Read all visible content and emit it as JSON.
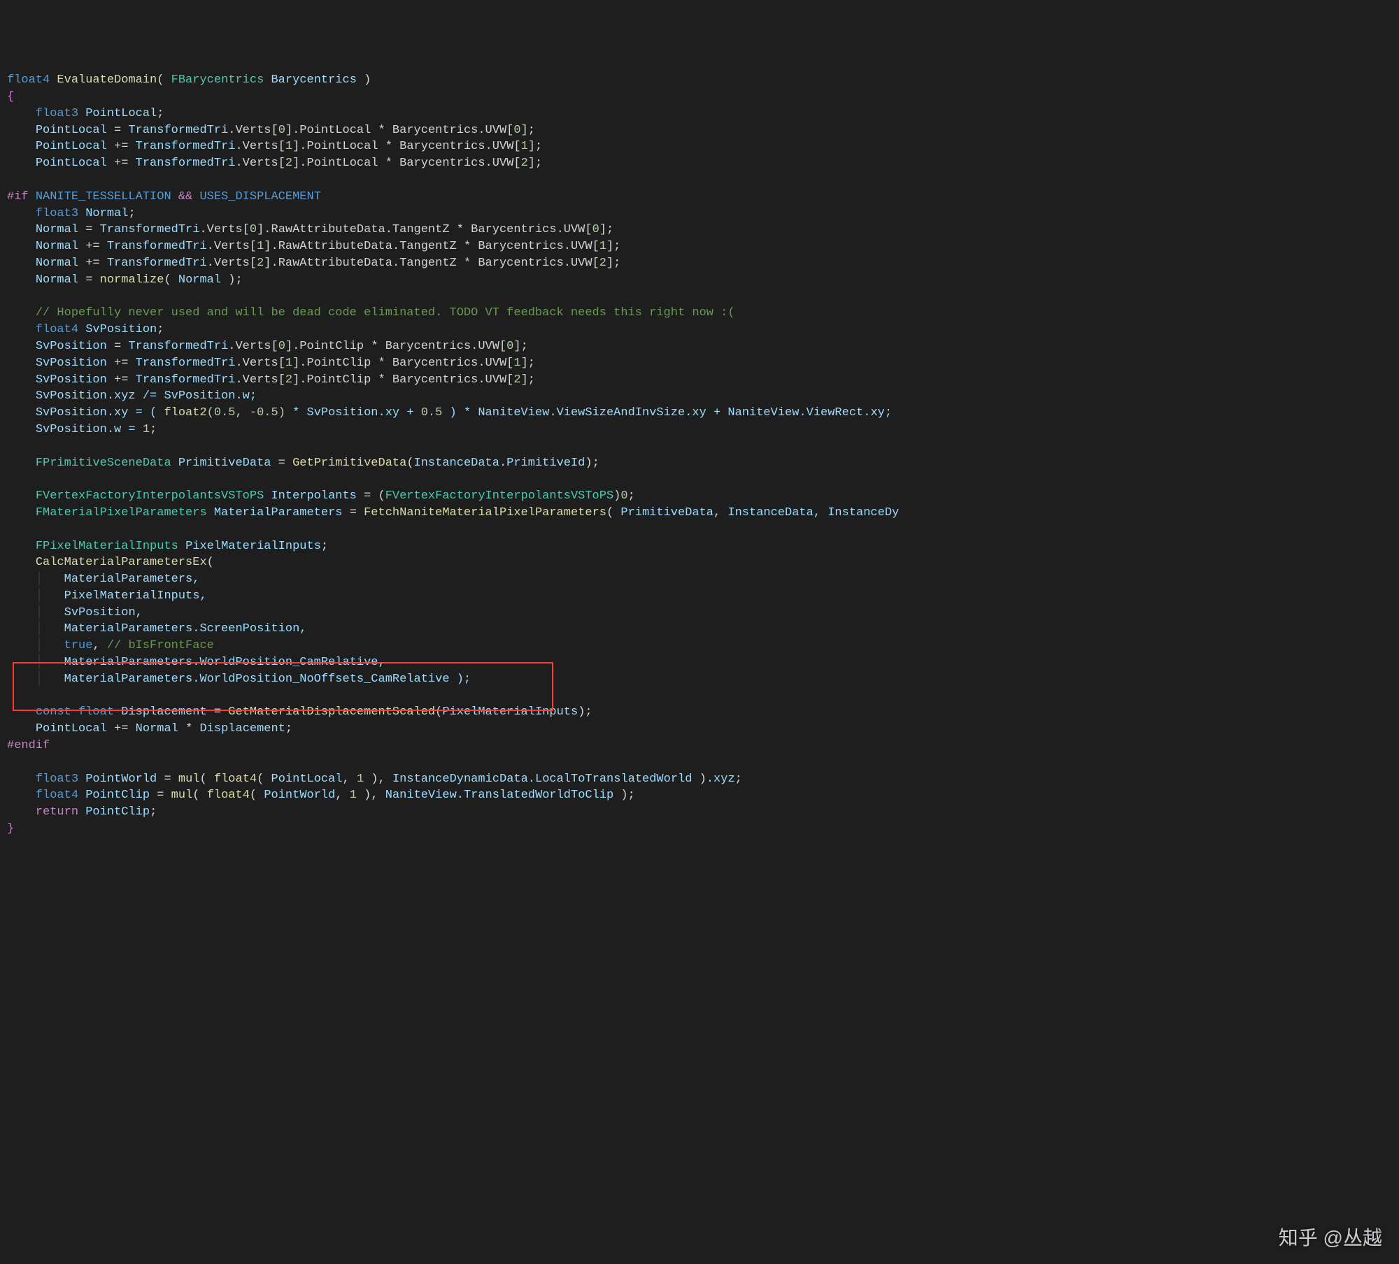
{
  "func_decl": {
    "ret": "float4",
    "name": "EvaluateDomain",
    "ptype": "FBarycentrics",
    "pname": "Barycentrics"
  },
  "l_open": "{",
  "l_close": "}",
  "pl_decl": {
    "t": "float3",
    "n": "PointLocal"
  },
  "pl1": {
    "lhs": "PointLocal",
    "op": " = ",
    "a": "TransformedTri",
    "b": ".Verts[",
    "i": "0",
    "c": "].PointLocal * Barycentrics.UVW[",
    "i2": "0",
    "d": "];"
  },
  "pl2": {
    "lhs": "PointLocal",
    "op": " += ",
    "a": "TransformedTri",
    "b": ".Verts[",
    "i": "1",
    "c": "].PointLocal * Barycentrics.UVW[",
    "i2": "1",
    "d": "];"
  },
  "pl3": {
    "lhs": "PointLocal",
    "op": " += ",
    "a": "TransformedTri",
    "b": ".Verts[",
    "i": "2",
    "c": "].PointLocal * Barycentrics.UVW[",
    "i2": "2",
    "d": "];"
  },
  "pp_if": {
    "d": "#if",
    "c1": "NANITE_TESSELLATION",
    "op": "&&",
    "c2": "USES_DISPLACEMENT"
  },
  "n_decl": {
    "t": "float3",
    "n": "Normal"
  },
  "n1": {
    "lhs": "Normal",
    "op": " = ",
    "a": "TransformedTri",
    "b": ".Verts[",
    "i": "0",
    "c": "].RawAttributeData.TangentZ * Barycentrics.UVW[",
    "i2": "0",
    "d": "];"
  },
  "n2": {
    "lhs": "Normal",
    "op": " += ",
    "a": "TransformedTri",
    "b": ".Verts[",
    "i": "1",
    "c": "].RawAttributeData.TangentZ * Barycentrics.UVW[",
    "i2": "1",
    "d": "];"
  },
  "n3": {
    "lhs": "Normal",
    "op": " += ",
    "a": "TransformedTri",
    "b": ".Verts[",
    "i": "2",
    "c": "].RawAttributeData.TangentZ * Barycentrics.UVW[",
    "i2": "2",
    "d": "];"
  },
  "n_norm": {
    "lhs": "Normal",
    "op": " = ",
    "fn": "normalize",
    "arg": "Normal"
  },
  "comment_dead": "// Hopefully never used and will be dead code eliminated. TODO VT feedback needs this right now :(",
  "sv_decl": {
    "t": "float4",
    "n": "SvPosition"
  },
  "sv1": {
    "lhs": "SvPosition",
    "op": " = ",
    "a": "TransformedTri",
    "b": ".Verts[",
    "i": "0",
    "c": "].PointClip * Barycentrics.UVW[",
    "i2": "0",
    "d": "];"
  },
  "sv2": {
    "lhs": "SvPosition",
    "op": " += ",
    "a": "TransformedTri",
    "b": ".Verts[",
    "i": "1",
    "c": "].PointClip * Barycentrics.UVW[",
    "i2": "1",
    "d": "];"
  },
  "sv3": {
    "lhs": "SvPosition",
    "op": " += ",
    "a": "TransformedTri",
    "b": ".Verts[",
    "i": "2",
    "c": "].PointClip * Barycentrics.UVW[",
    "i2": "2",
    "d": "];"
  },
  "sv_div": "SvPosition.xyz /= SvPosition.w;",
  "sv_xy": {
    "pre": "SvPosition.xy = ( ",
    "fn": "float2",
    "args": "(0.5, -0.5)",
    "mid": " * SvPosition.xy + ",
    "half": "0.5",
    " rest": " ) * NaniteView.ViewSizeAndInvSize.xy + NaniteView.ViewRect.xy;"
  },
  "sv_w": {
    "pre": "SvPosition.w = ",
    "v": "1",
    "post": ";"
  },
  "prim": {
    "t": "FPrimitiveSceneData",
    "n": "PrimitiveData",
    "fn": "GetPrimitiveData",
    "arg": "InstanceData.PrimitiveId"
  },
  "interp": {
    "t": "FVertexFactoryInterpolantsVSToPS",
    "n": "Interpolants",
    "cast": "FVertexFactoryInterpolantsVSToPS",
    "z": "0"
  },
  "matparam": {
    "t": "FMaterialPixelParameters",
    "n": "MaterialParameters",
    "fn": "FetchNaniteMaterialPixelParameters",
    "args": "PrimitiveData, InstanceData, InstanceDy"
  },
  "pmi": {
    "t": "FPixelMaterialInputs",
    "n": "PixelMaterialInputs"
  },
  "calc": {
    "fn": "CalcMaterialParametersEx"
  },
  "arg1": "MaterialParameters,",
  "arg2": "PixelMaterialInputs,",
  "arg3": "SvPosition,",
  "arg4": "MaterialParameters.ScreenPosition,",
  "arg5": {
    "v": "true",
    "c": "// bIsFrontFace"
  },
  "arg6": "MaterialParameters.WorldPosition_CamRelative,",
  "arg7": "MaterialParameters.WorldPosition_NoOffsets_CamRelative );",
  "disp": {
    "kw": "const",
    "t": "float",
    "n": "Displacement",
    "fn": "GetMaterialDisplacementScaled",
    "arg": "PixelMaterialInputs"
  },
  "pl_add": {
    "lhs": "PointLocal",
    "op": " += ",
    "a": "Normal",
    "b": " * ",
    "c": "Displacement",
    "d": ";"
  },
  "pp_endif": "#endif",
  "pw": {
    "t": "float3",
    "n": "PointWorld",
    "fn": "mul",
    "f2": "float4",
    "a": "PointLocal",
    "one": "1",
    "m": "InstanceDynamicData.LocalToTranslatedWorld",
    "sw": ".xyz"
  },
  "pc": {
    "t": "float4",
    "n": "PointClip",
    "fn": "mul",
    "f2": "float4",
    "a": "PointWorld",
    "one": "1",
    "m": "NaniteView.TranslatedWorldToClip"
  },
  "ret": {
    "kw": "return",
    "n": "PointClip"
  },
  "watermark": "知乎 @丛越"
}
